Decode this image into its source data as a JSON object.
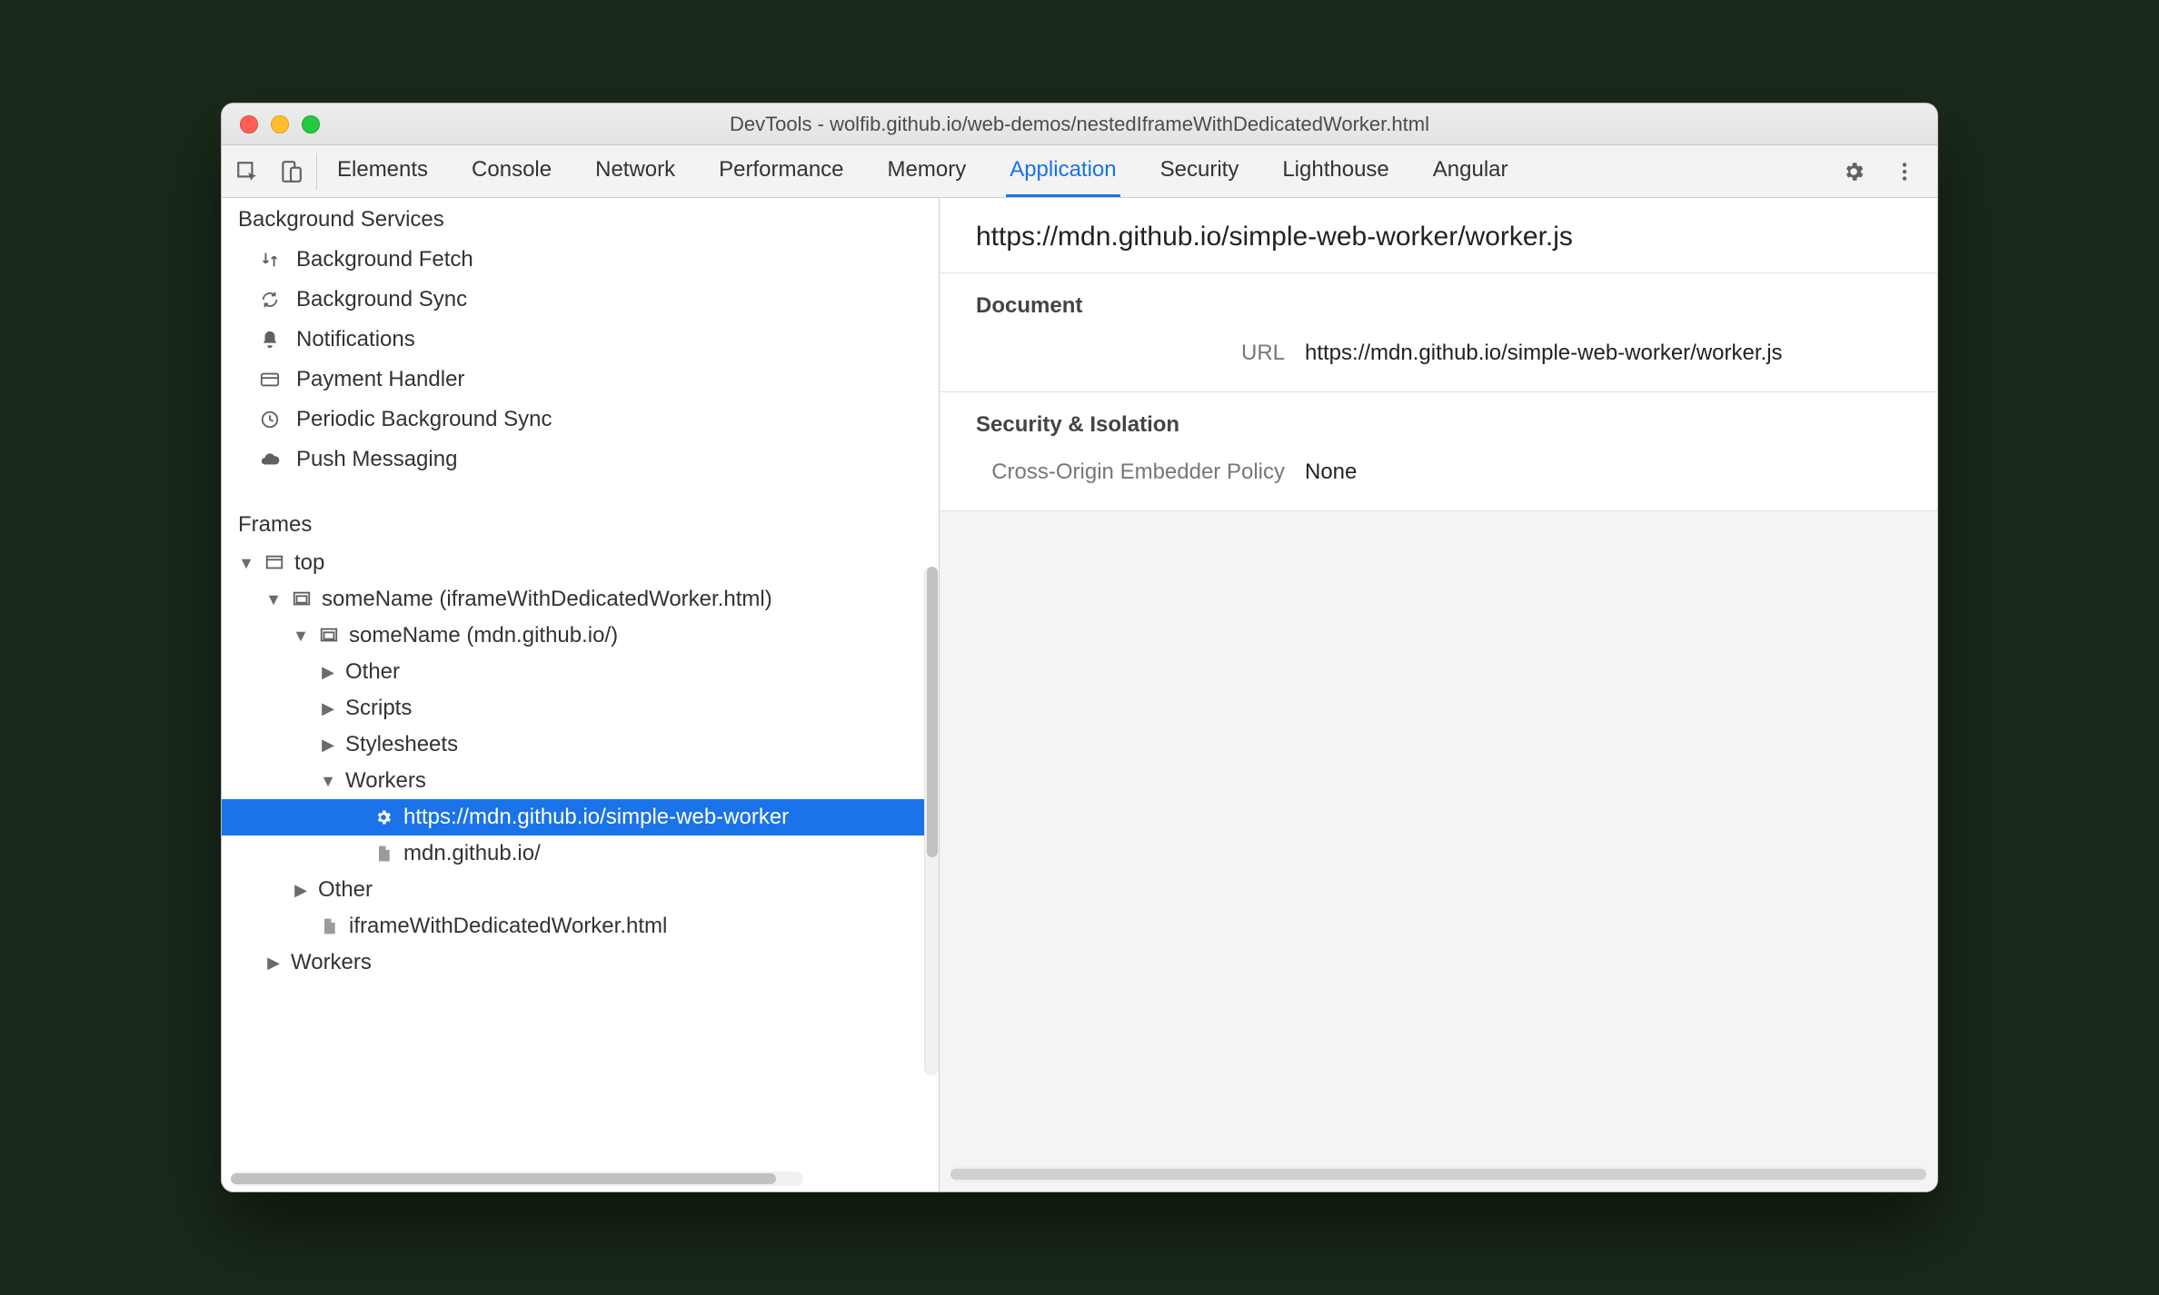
{
  "window": {
    "title": "DevTools - wolfib.github.io/web-demos/nestedIframeWithDedicatedWorker.html"
  },
  "tabs": {
    "items": [
      "Elements",
      "Console",
      "Network",
      "Performance",
      "Memory",
      "Application",
      "Security",
      "Lighthouse",
      "Angular"
    ],
    "active": "Application"
  },
  "sidebar": {
    "background_services_title": "Background Services",
    "services": [
      {
        "icon": "swap-icon",
        "label": "Background Fetch"
      },
      {
        "icon": "sync-icon",
        "label": "Background Sync"
      },
      {
        "icon": "bell-icon",
        "label": "Notifications"
      },
      {
        "icon": "card-icon",
        "label": "Payment Handler"
      },
      {
        "icon": "clock-icon",
        "label": "Periodic Background Sync"
      },
      {
        "icon": "cloud-icon",
        "label": "Push Messaging"
      }
    ],
    "frames_title": "Frames",
    "tree": {
      "top": "top",
      "iframe1": "someName (iframeWithDedicatedWorker.html)",
      "iframe2": "someName (mdn.github.io/)",
      "other": "Other",
      "scripts": "Scripts",
      "stylesheets": "Stylesheets",
      "workers": "Workers",
      "worker_url": "https://mdn.github.io/simple-web-worker",
      "mdn_root": "mdn.github.io/",
      "other2": "Other",
      "iframe_file": "iframeWithDedicatedWorker.html",
      "workers2": "Workers"
    }
  },
  "main": {
    "heading": "https://mdn.github.io/simple-web-worker/worker.js",
    "document": {
      "title": "Document",
      "url_label": "URL",
      "url_value": "https://mdn.github.io/simple-web-worker/worker.js"
    },
    "security": {
      "title": "Security & Isolation",
      "coep_label": "Cross-Origin Embedder Policy",
      "coep_value": "None"
    }
  }
}
